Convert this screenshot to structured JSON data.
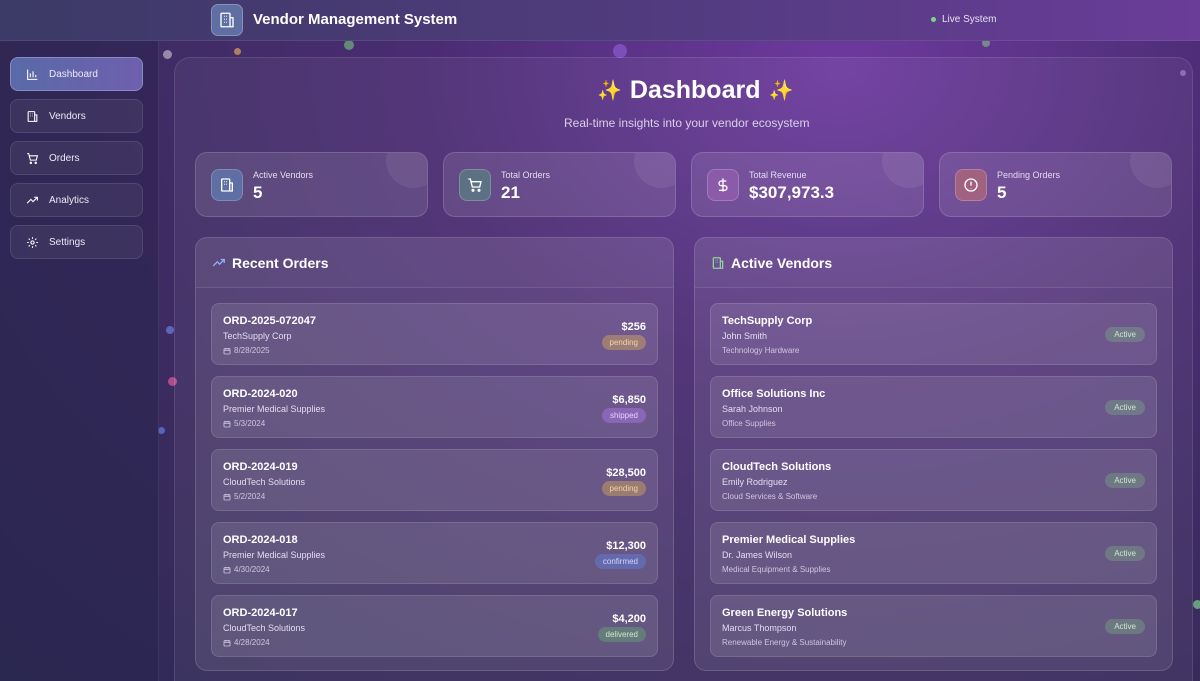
{
  "header": {
    "title": "Vendor Management System",
    "status": "Live System",
    "logo_icon": "building-icon"
  },
  "sidebar": {
    "items": [
      {
        "label": "Dashboard",
        "icon": "bar-chart-icon",
        "active": true
      },
      {
        "label": "Vendors",
        "icon": "building-icon",
        "active": false
      },
      {
        "label": "Orders",
        "icon": "cart-icon",
        "active": false
      },
      {
        "label": "Analytics",
        "icon": "trending-up-icon",
        "active": false
      },
      {
        "label": "Settings",
        "icon": "gear-icon",
        "active": false
      }
    ]
  },
  "hero": {
    "title": "Dashboard",
    "subtitle": "Real-time insights into your vendor ecosystem"
  },
  "stats": [
    {
      "label": "Active Vendors",
      "value": "5",
      "icon": "building-icon",
      "color": "#5f6ea3"
    },
    {
      "label": "Total Orders",
      "value": "21",
      "icon": "cart-icon",
      "color": "#5d7184"
    },
    {
      "label": "Total Revenue",
      "value": "$307,973.3",
      "icon": "dollar-icon",
      "color": "#8b5aa8"
    },
    {
      "label": "Pending Orders",
      "value": "5",
      "icon": "alert-circle-icon",
      "color": "#a06280"
    }
  ],
  "recent_orders": {
    "title": "Recent Orders",
    "items": [
      {
        "id": "ORD-2025-072047",
        "vendor": "TechSupply Corp",
        "date": "8/28/2025",
        "amount": "$256",
        "status": "pending"
      },
      {
        "id": "ORD-2024-020",
        "vendor": "Premier Medical Supplies",
        "date": "5/3/2024",
        "amount": "$6,850",
        "status": "shipped"
      },
      {
        "id": "ORD-2024-019",
        "vendor": "CloudTech Solutions",
        "date": "5/2/2024",
        "amount": "$28,500",
        "status": "pending"
      },
      {
        "id": "ORD-2024-018",
        "vendor": "Premier Medical Supplies",
        "date": "4/30/2024",
        "amount": "$12,300",
        "status": "confirmed"
      },
      {
        "id": "ORD-2024-017",
        "vendor": "CloudTech Solutions",
        "date": "4/28/2024",
        "amount": "$4,200",
        "status": "delivered"
      }
    ]
  },
  "active_vendors": {
    "title": "Active Vendors",
    "items": [
      {
        "name": "TechSupply Corp",
        "contact": "John Smith",
        "category": "Technology Hardware",
        "status": "Active"
      },
      {
        "name": "Office Solutions Inc",
        "contact": "Sarah Johnson",
        "category": "Office Supplies",
        "status": "Active"
      },
      {
        "name": "CloudTech Solutions",
        "contact": "Emily Rodriguez",
        "category": "Cloud Services & Software",
        "status": "Active"
      },
      {
        "name": "Premier Medical Supplies",
        "contact": "Dr. James Wilson",
        "category": "Medical Equipment & Supplies",
        "status": "Active"
      },
      {
        "name": "Green Energy Solutions",
        "contact": "Marcus Thompson",
        "category": "Renewable Energy & Sustainability",
        "status": "Active"
      }
    ]
  }
}
